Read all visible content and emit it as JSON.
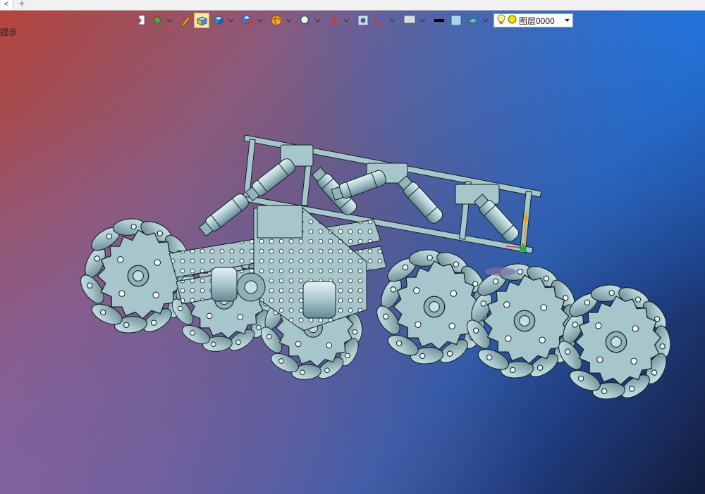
{
  "tabs": {
    "back_glyph": "<",
    "add_glyph": "+"
  },
  "hint_text": "提示.",
  "toolbar": {
    "icons": [
      "exit-sketch-icon",
      "paint-bucket-icon",
      "pen-icon",
      "solid-box-active-icon",
      "cube-icon",
      "view-orient-icon",
      "render-sphere-icon",
      "zoom-fit-icon",
      "axis-icon",
      "section-icon",
      "ruler-icon",
      "display-monitor-icon",
      "black-rect-icon",
      "plane-icon",
      "visibility-icon"
    ],
    "layer": {
      "label": "图层0000",
      "bulb": "light-bulb-icon",
      "color_dot": "#f2e200"
    }
  },
  "colors": {
    "model_fill": "#a7c6cc",
    "model_dark": "#6e9197",
    "model_edge": "#102226",
    "active_tool_bg": "#fbe7a8"
  },
  "model": {
    "name": "mecanum-wheel-robot-chassis"
  }
}
